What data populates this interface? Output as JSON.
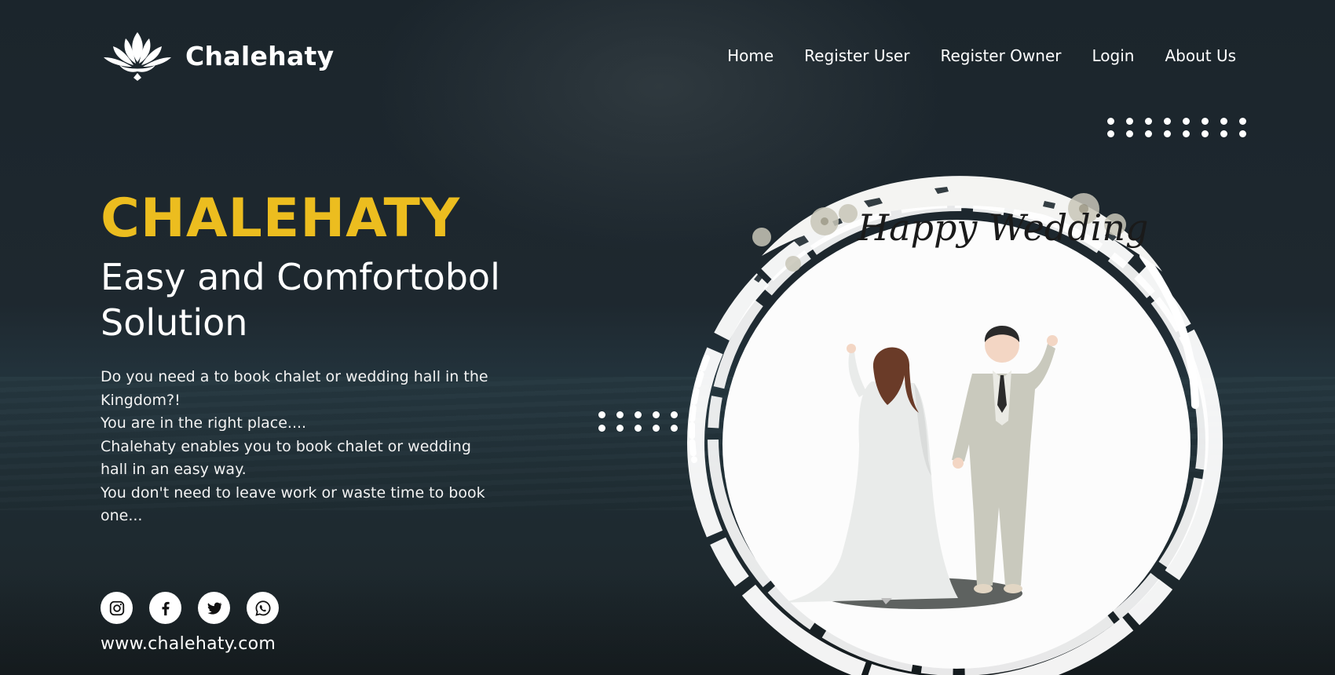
{
  "brand": {
    "name": "Chalehaty",
    "logo_icon": "lotus-icon"
  },
  "nav": {
    "items": [
      {
        "label": "Home"
      },
      {
        "label": "Register User"
      },
      {
        "label": "Register Owner"
      },
      {
        "label": "Login"
      },
      {
        "label": "About Us"
      }
    ]
  },
  "hero": {
    "title": "CHALEHATY",
    "subtitle": "Easy and Comfortobol Solution",
    "paragraphs": [
      "Do you need a to book chalet or wedding hall in the Kingdom?!",
      "You are in the right place....",
      "Chalehaty enables you to book chalet or wedding hall in an easy way.",
      "You don't need to leave work or waste time to book one..."
    ]
  },
  "social": {
    "icons": [
      "instagram-icon",
      "facebook-icon",
      "twitter-icon",
      "whatsapp-icon"
    ]
  },
  "footer": {
    "url": "www.chalehaty.com"
  },
  "illustration": {
    "caption": "Happy Wedding"
  },
  "colors": {
    "accent": "#ecbd1f",
    "background": "#1c262c",
    "text": "#ffffff"
  }
}
